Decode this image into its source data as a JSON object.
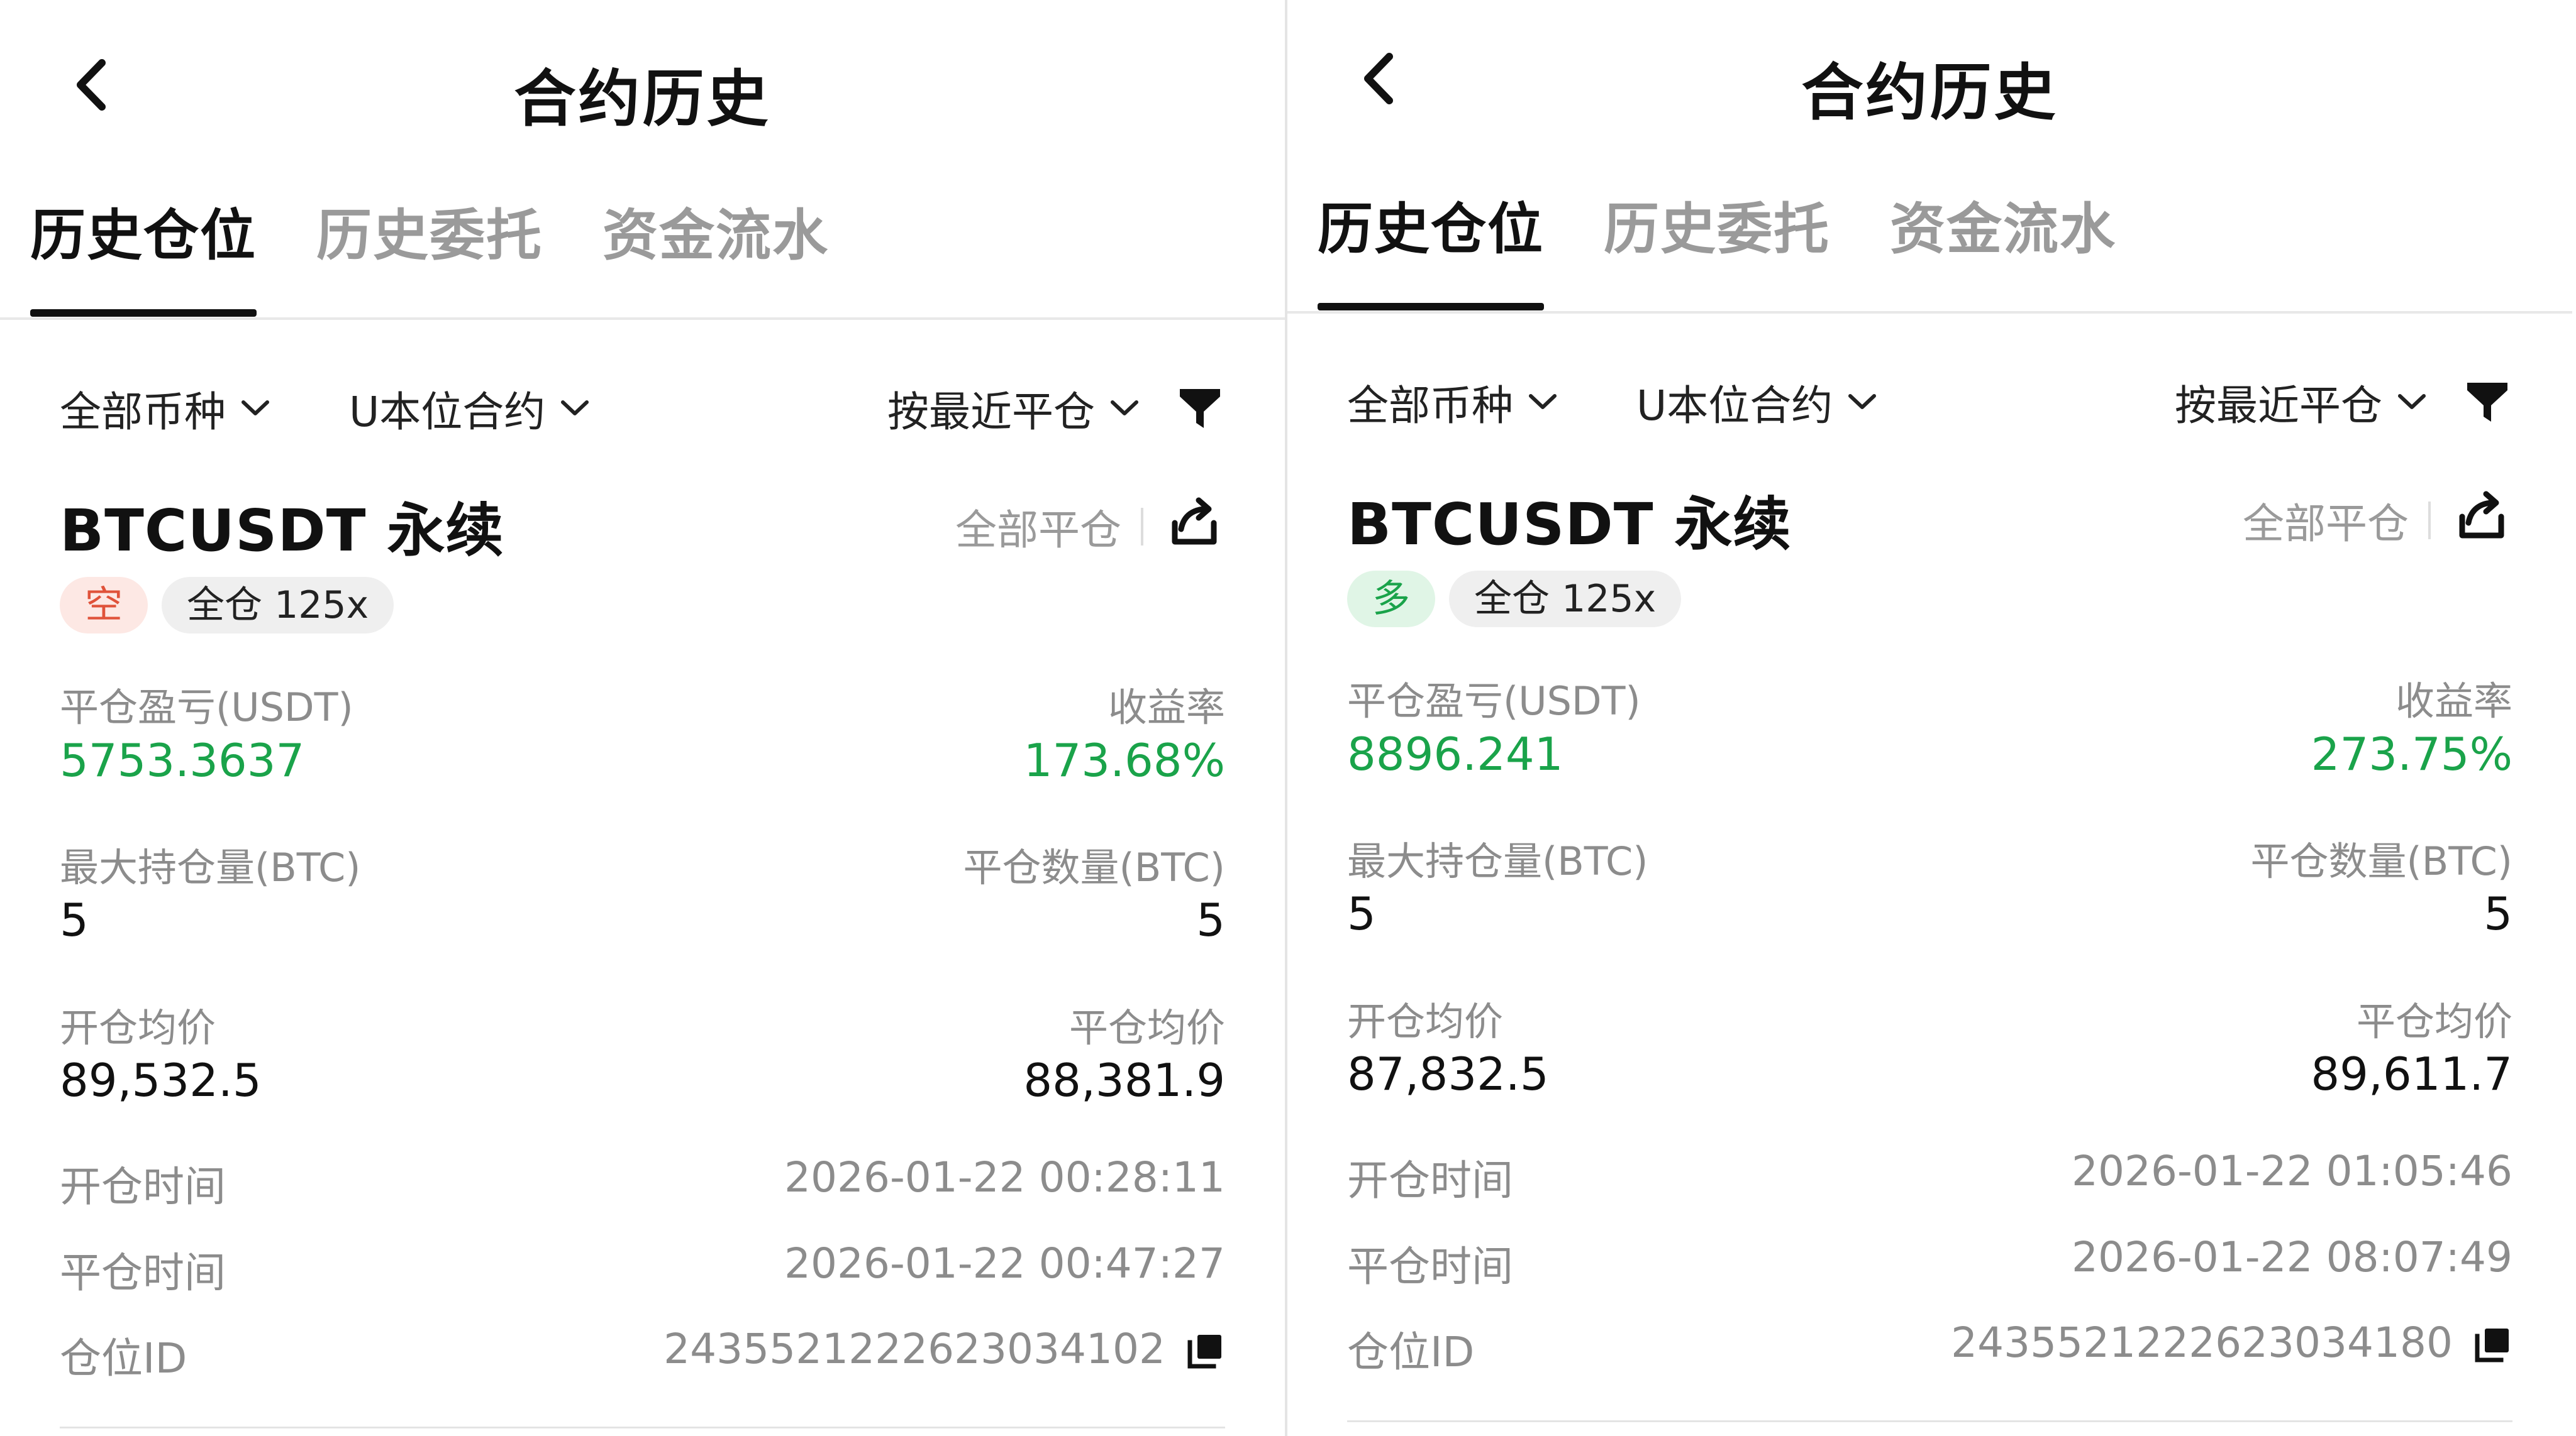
{
  "panes": [
    {
      "header": {
        "title": "合约历史"
      },
      "tabs": [
        {
          "label": "历史仓位"
        },
        {
          "label": "历史委托"
        },
        {
          "label": "资金流水"
        }
      ],
      "filters": {
        "coin": "全部币种",
        "contract": "U本位合约",
        "sort": "按最近平仓"
      },
      "position": {
        "symbol": "BTCUSDT 永续",
        "close_all": "全部平仓",
        "side": "空",
        "margin_mode": "全仓 125x",
        "pnl_label": "平仓盈亏(USDT)",
        "pnl": "5753.3637",
        "roi_label": "收益率",
        "roi": "173.68%",
        "max_pos_label": "最大持仓量(BTC)",
        "max_pos": "5",
        "close_qty_label": "平仓数量(BTC)",
        "close_qty": "5",
        "open_avg_label": "开仓均价",
        "open_avg": "89,532.5",
        "close_avg_label": "平仓均价",
        "close_avg": "88,381.9",
        "open_time_label": "开仓时间",
        "open_time": "2026-01-22 00:28:11",
        "close_time_label": "平仓时间",
        "close_time": "2026-01-22 00:47:27",
        "pos_id_label": "仓位ID",
        "pos_id": "2435521222623034102"
      }
    },
    {
      "header": {
        "title": "合约历史"
      },
      "tabs": [
        {
          "label": "历史仓位"
        },
        {
          "label": "历史委托"
        },
        {
          "label": "资金流水"
        }
      ],
      "filters": {
        "coin": "全部币种",
        "contract": "U本位合约",
        "sort": "按最近平仓"
      },
      "position": {
        "symbol": "BTCUSDT 永续",
        "close_all": "全部平仓",
        "side": "多",
        "margin_mode": "全仓 125x",
        "pnl_label": "平仓盈亏(USDT)",
        "pnl": "8896.241",
        "roi_label": "收益率",
        "roi": "273.75%",
        "max_pos_label": "最大持仓量(BTC)",
        "max_pos": "5",
        "close_qty_label": "平仓数量(BTC)",
        "close_qty": "5",
        "open_avg_label": "开仓均价",
        "open_avg": "87,832.5",
        "close_avg_label": "平仓均价",
        "close_avg": "89,611.7",
        "open_time_label": "开仓时间",
        "open_time": "2026-01-22 01:05:46",
        "close_time_label": "平仓时间",
        "close_time": "2026-01-22 08:07:49",
        "pos_id_label": "仓位ID",
        "pos_id": "2435521222623034180"
      }
    }
  ],
  "colors": {
    "profit": "#1aa34a",
    "short": "#e0523a",
    "muted": "#8c8c8c",
    "text": "#111111"
  },
  "icons": [
    "back-arrow-icon",
    "chevron-down-icon",
    "filter-funnel-icon",
    "share-icon",
    "copy-icon"
  ]
}
